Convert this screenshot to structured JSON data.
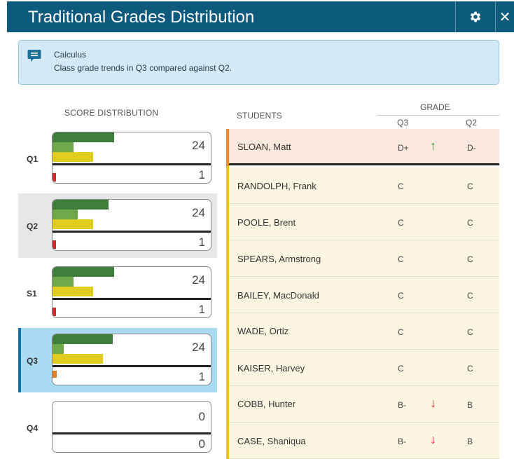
{
  "header": {
    "title": "Traditional Grades Distribution",
    "settings_icon": "gear-icon",
    "close_label": "✕"
  },
  "banner": {
    "icon": "message-icon",
    "course": "Calculus",
    "description": "Class grade trends in Q3 compared against Q2."
  },
  "score_distribution": {
    "header": "SCORE DISTRIBUTION",
    "terms": [
      {
        "label": "Q1",
        "top_count": "24",
        "bottom_count": "1",
        "fail_color": "#cc2b2b"
      },
      {
        "label": "Q2",
        "top_count": "24",
        "bottom_count": "1",
        "fail_color": "#cc2b2b"
      },
      {
        "label": "S1",
        "top_count": "24",
        "bottom_count": "1",
        "fail_color": "#cc2b2b"
      },
      {
        "label": "Q3",
        "top_count": "24",
        "bottom_count": "1",
        "fail_color": "#e07d22"
      },
      {
        "label": "Q4",
        "top_count": "0",
        "bottom_count": "0",
        "fail_color": ""
      }
    ],
    "selected": "Q3"
  },
  "students": {
    "header": "STUDENTS",
    "grade_header": "GRADE",
    "col_q3": "Q3",
    "col_q2": "Q2",
    "rows": [
      {
        "name": "SLOAN, Matt",
        "q3": "D+",
        "trend": "↑",
        "q2": "D-"
      },
      {
        "name": "RANDOLPH, Frank",
        "q3": "C",
        "trend": "",
        "q2": "C"
      },
      {
        "name": "POOLE, Brent",
        "q3": "C",
        "trend": "",
        "q2": "C"
      },
      {
        "name": "SPEARS, Armstrong",
        "q3": "C",
        "trend": "",
        "q2": "C"
      },
      {
        "name": "BAILEY, MacDonald",
        "q3": "C",
        "trend": "",
        "q2": "C"
      },
      {
        "name": "WADE, Ortiz",
        "q3": "C",
        "trend": "",
        "q2": "C"
      },
      {
        "name": "KAISER, Harvey",
        "q3": "C",
        "trend": "",
        "q2": "C"
      },
      {
        "name": "COBB, Hunter",
        "q3": "B-",
        "trend": "↓",
        "q2": "B"
      },
      {
        "name": "CASE, Shaniqua",
        "q3": "B-",
        "trend": "↓",
        "q2": "B"
      }
    ]
  },
  "colors": {
    "header_bg": "#0d5a7d",
    "banner_bg": "#d3eaf6",
    "selected_term_bg": "#a9dbf2",
    "grade_a": "#3e7d3a",
    "grade_b": "#6fa84a",
    "grade_c": "#e2cb1f",
    "trend_up": "#2f9a3a",
    "trend_down": "#d93030"
  }
}
